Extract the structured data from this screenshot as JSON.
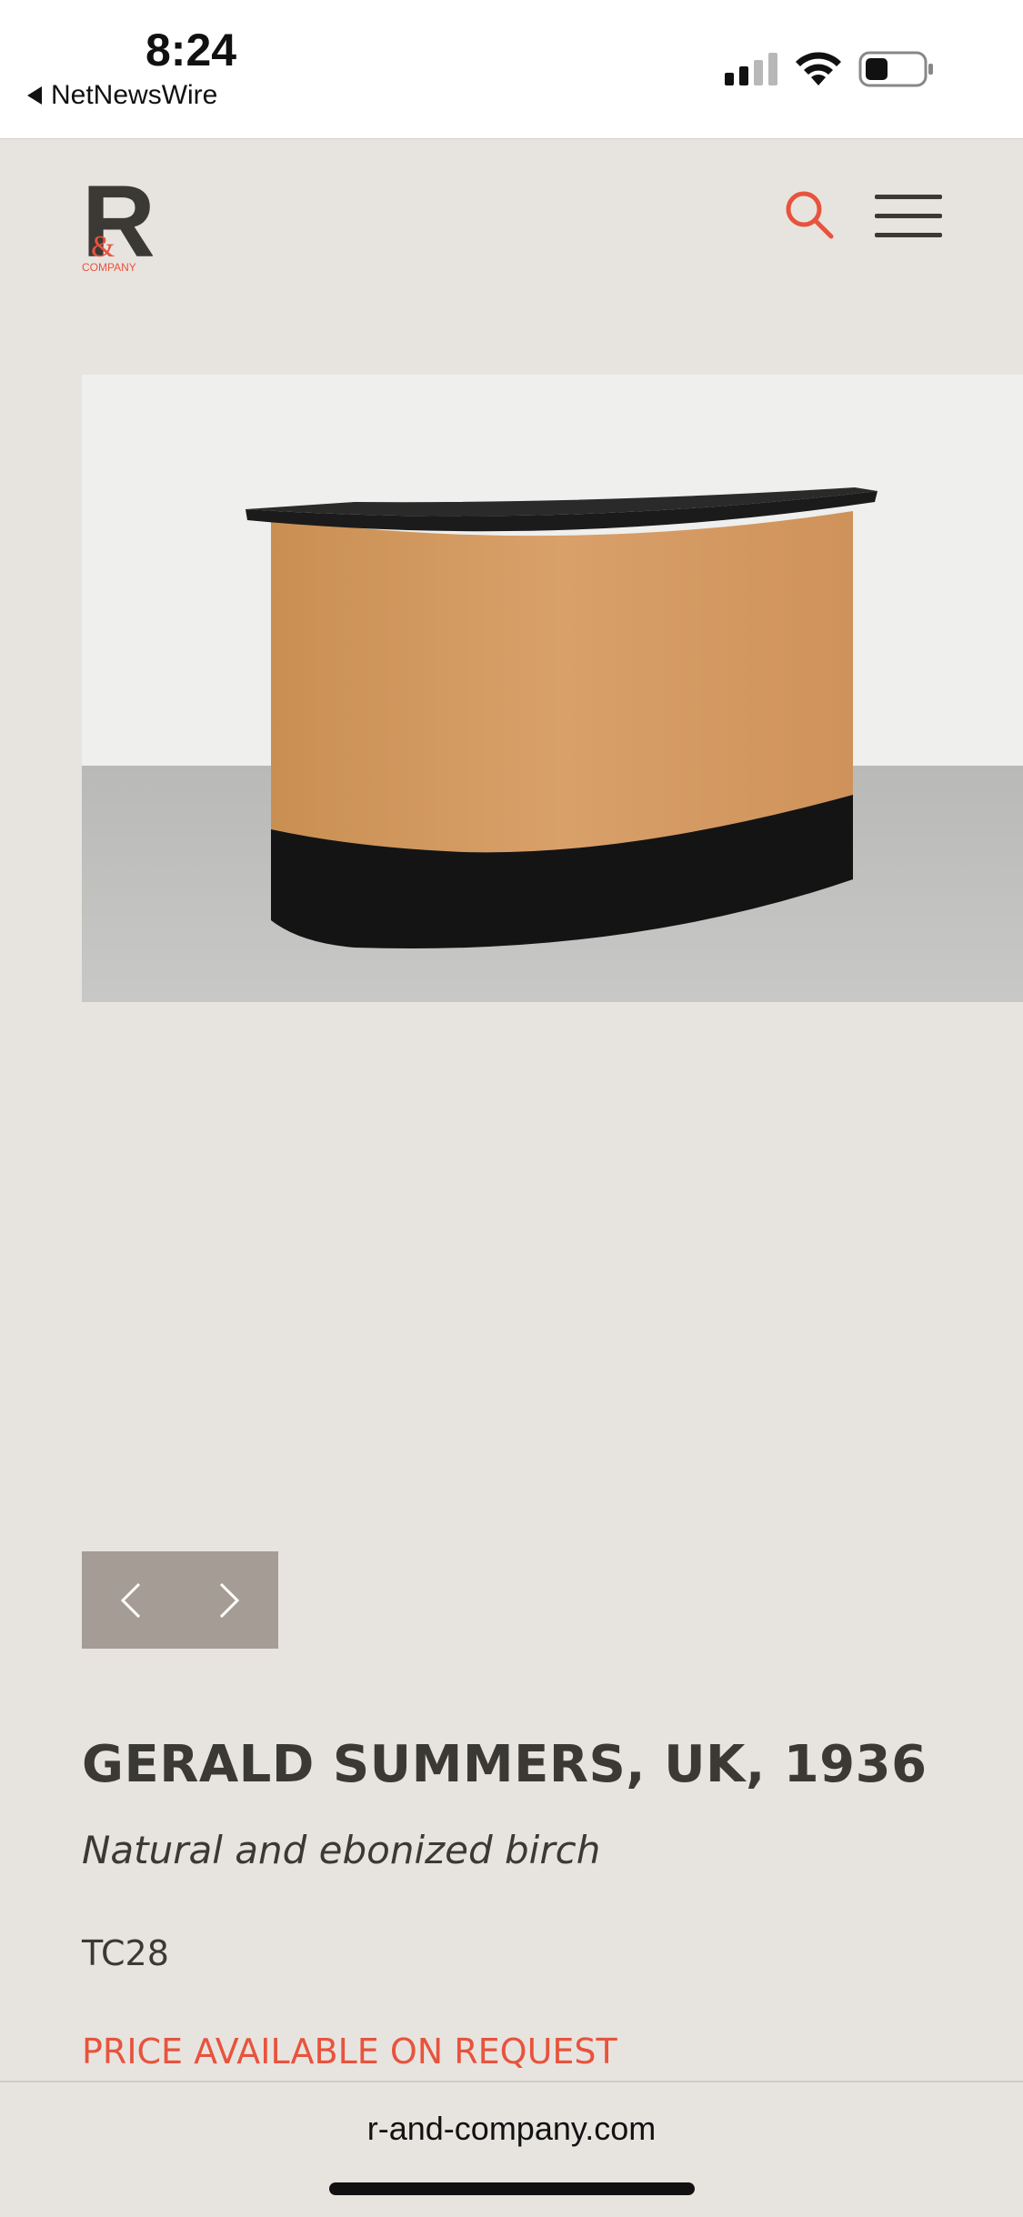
{
  "status_bar": {
    "time": "8:24",
    "back_app": "NetNewsWire"
  },
  "header": {
    "logo_letter": "R",
    "logo_amp": "&",
    "logo_text": "COMPANY",
    "accent_color": "#e8533d"
  },
  "product": {
    "title": "GERALD SUMMERS, UK, 1936",
    "material": "Natural and ebonized birch",
    "reference": "TC28",
    "price": "PRICE AVAILABLE ON REQUEST"
  },
  "carousel": {
    "prev_icon": "chevron-left-icon",
    "next_icon": "chevron-right-icon"
  },
  "browser": {
    "url": "r-and-company.com"
  }
}
